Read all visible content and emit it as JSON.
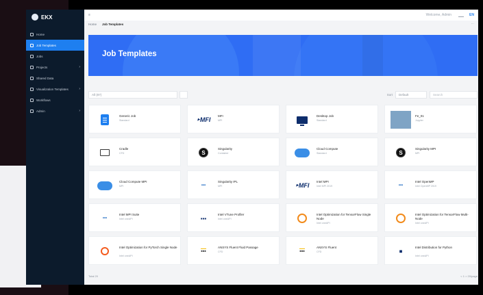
{
  "app": {
    "brand": "EKX"
  },
  "sidebar": {
    "items": [
      {
        "label": "Home",
        "icon": "home-icon",
        "active": false
      },
      {
        "label": "Job Templates",
        "icon": "template-icon",
        "active": true
      },
      {
        "label": "Jobs",
        "icon": "jobs-icon",
        "active": false
      },
      {
        "label": "Projects",
        "icon": "folder-icon",
        "active": false,
        "expandable": true
      },
      {
        "label": "Shared Data",
        "icon": "data-icon",
        "active": false
      },
      {
        "label": "Visualization Templates",
        "icon": "visual-icon",
        "active": false,
        "expandable": true
      },
      {
        "label": "Workflows",
        "icon": "workflow-icon",
        "active": false
      },
      {
        "label": "Admin",
        "icon": "admin-icon",
        "active": false,
        "expandable": true
      }
    ]
  },
  "topbar": {
    "user": "Welcome, Admin",
    "lang": "EN"
  },
  "tabs": {
    "home": "Home",
    "current": "Job Templates"
  },
  "banner": {
    "title": "Job Templates"
  },
  "toolbar": {
    "filter_placeholder": "All (87)",
    "sort_label": "Sort",
    "sort_value": "Default",
    "search_placeholder": "Search"
  },
  "cards": [
    {
      "title": "Generic Job",
      "sub": "Standard",
      "logo": "doc"
    },
    {
      "title": "MFI",
      "sub": "MPI",
      "logo": "mfi"
    },
    {
      "title": "Desktop Job",
      "sub": "Standard",
      "logo": "monitor"
    },
    {
      "title": "Fe_01",
      "sub": "Jupyter",
      "logo": "photo"
    },
    {
      "title": "Cradle",
      "sub": "CFD",
      "logo": "box"
    },
    {
      "title": "Singularity",
      "sub": "Container",
      "logo": "s"
    },
    {
      "title": "Cloud Compute",
      "sub": "Standard",
      "logo": "cloud"
    },
    {
      "title": "Singularity MPI",
      "sub": "MPI",
      "logo": "s"
    },
    {
      "title": "Cloud Compute MPI",
      "sub": "MPI",
      "logo": "cloud"
    },
    {
      "title": "Singularity IPL",
      "sub": "MPI",
      "logo": "blue-text"
    },
    {
      "title": "Intel MPI",
      "sub": "Intel MPI 2019",
      "logo": "mfi"
    },
    {
      "title": "Intel OpenMP",
      "sub": "Intel OpenMP 2019",
      "logo": "openmp"
    },
    {
      "title": "Intel MPI Suite",
      "sub": "Intel oneAPI",
      "logo": "neptune"
    },
    {
      "title": "Intel VTune Profiler",
      "sub": "Intel oneAPI",
      "logo": "vtune"
    },
    {
      "title": "Intel Optimization for TensorFlow Single Node",
      "sub": "Intel oneAPI",
      "logo": "orange"
    },
    {
      "title": "Intel Optimization for TensorFlow Multi-Node",
      "sub": "Intel oneAPI",
      "logo": "orange"
    },
    {
      "title": "Intel Optimization for PyTorch Single Node",
      "sub": "Intel oneAPI",
      "logo": "power"
    },
    {
      "title": "ANSYS Fluent Fluid Passage",
      "sub": "CFD",
      "logo": "ansys"
    },
    {
      "title": "ANSYS Fluent",
      "sub": "CFD",
      "logo": "ansys"
    },
    {
      "title": "Intel Distribution for Python",
      "sub": "Intel oneAPI",
      "logo": "one"
    }
  ],
  "pager": {
    "total": "Total 20",
    "pages": "< 1 >  20/page"
  },
  "colors": {
    "accent": "#1e7ff0",
    "sidebar": "#0c1b2c",
    "banner": "#2f6df4"
  }
}
